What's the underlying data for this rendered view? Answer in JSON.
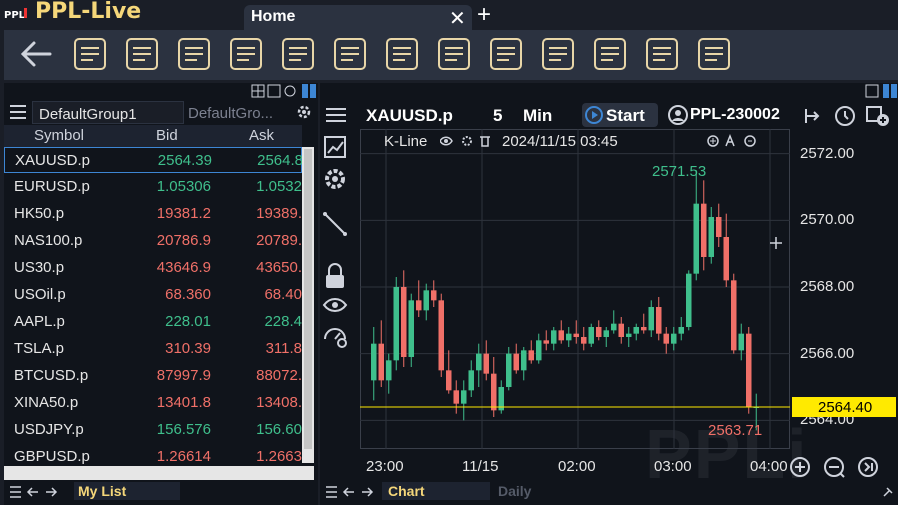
{
  "app": {
    "title": "PPL-Live",
    "logo_text": "PPLi"
  },
  "tabs": [
    {
      "label": "Home"
    }
  ],
  "toolbar_icons": [
    "list-icon",
    "favorite-list-icon",
    "favorite-settings-icon",
    "chart-signals-icon",
    "bar-chart-signals-icon",
    "strategy-cycle-icon",
    "flash-trade-icon",
    "calendar-icon",
    "lab-icon",
    "terminal-play-icon",
    "calculator-icon",
    "search-report-icon",
    "invoice-icon"
  ],
  "watchlist": {
    "groups": [
      "DefaultGroup1",
      "DefaultGro..."
    ],
    "columns": [
      "Symbol",
      "Bid",
      "Ask"
    ],
    "rows": [
      {
        "symbol": "XAUUSD.p",
        "bid": "2564.39",
        "ask": "2564.8",
        "dir": "up"
      },
      {
        "symbol": "EURUSD.p",
        "bid": "1.05306",
        "ask": "1.0532",
        "dir": "up"
      },
      {
        "symbol": "HK50.p",
        "bid": "19381.2",
        "ask": "19389.",
        "dir": "dn"
      },
      {
        "symbol": "NAS100.p",
        "bid": "20786.9",
        "ask": "20789.",
        "dir": "dn"
      },
      {
        "symbol": "US30.p",
        "bid": "43646.9",
        "ask": "43650.",
        "dir": "dn"
      },
      {
        "symbol": "USOil.p",
        "bid": "68.360",
        "ask": "68.40",
        "dir": "dn"
      },
      {
        "symbol": "AAPL.p",
        "bid": "228.01",
        "ask": "228.4",
        "dir": "up"
      },
      {
        "symbol": "TSLA.p",
        "bid": "310.39",
        "ask": "311.8",
        "dir": "dn"
      },
      {
        "symbol": "BTCUSD.p",
        "bid": "87997.9",
        "ask": "88072.",
        "dir": "dn"
      },
      {
        "symbol": "XINA50.p",
        "bid": "13401.8",
        "ask": "13408.",
        "dir": "dn"
      },
      {
        "symbol": "USDJPY.p",
        "bid": "156.576",
        "ask": "156.60",
        "dir": "up"
      },
      {
        "symbol": "GBPUSD.p",
        "bid": "1.26614",
        "ask": "1.2663",
        "dir": "dn"
      }
    ],
    "footer_tab": "My List"
  },
  "chart": {
    "symbol": "XAUUSD.p",
    "period": "5",
    "period_unit": "Min",
    "start_label": "Start",
    "account": "PPL-230002",
    "kline_label": "K-Line",
    "datetime": "2024/11/15 03:45",
    "y_ticks": [
      "2572.00",
      "2570.00",
      "2568.00",
      "2566.00",
      "2564.00"
    ],
    "x_ticks": [
      "23:00",
      "11/15",
      "02:00",
      "03:00",
      "04:00"
    ],
    "current_price": "2564.40",
    "high_label": "2571.53",
    "low_label": "2563.71",
    "footer_tabs": [
      "Chart",
      "Daily"
    ],
    "colors": {
      "up": "#3fbf8c",
      "down": "#f07068",
      "price_line": "#ffea00"
    }
  },
  "chart_data": {
    "type": "candlestick",
    "ylim": [
      2563.5,
      2572.5
    ],
    "ohlc": [
      [
        2565.2,
        2566.8,
        2564.6,
        2566.3
      ],
      [
        2566.3,
        2567.0,
        2565.0,
        2565.2
      ],
      [
        2565.2,
        2566.0,
        2564.8,
        2565.8
      ],
      [
        2565.8,
        2568.3,
        2565.5,
        2568.0
      ],
      [
        2568.0,
        2568.5,
        2565.6,
        2565.9
      ],
      [
        2565.9,
        2567.8,
        2565.6,
        2567.6
      ],
      [
        2567.6,
        2568.2,
        2567.1,
        2567.3
      ],
      [
        2567.3,
        2568.1,
        2567.0,
        2567.9
      ],
      [
        2567.9,
        2568.2,
        2567.4,
        2567.6
      ],
      [
        2567.6,
        2567.8,
        2565.3,
        2565.5
      ],
      [
        2565.5,
        2566.1,
        2564.8,
        2564.9
      ],
      [
        2564.9,
        2565.2,
        2564.2,
        2564.5
      ],
      [
        2564.5,
        2565.2,
        2564.0,
        2564.9
      ],
      [
        2564.9,
        2565.8,
        2564.7,
        2565.5
      ],
      [
        2565.5,
        2566.3,
        2565.0,
        2566.0
      ],
      [
        2566.0,
        2566.4,
        2565.2,
        2565.4
      ],
      [
        2565.4,
        2565.9,
        2564.1,
        2564.3
      ],
      [
        2564.3,
        2565.2,
        2564.2,
        2565.0
      ],
      [
        2565.0,
        2566.2,
        2564.9,
        2566.0
      ],
      [
        2566.0,
        2566.3,
        2565.4,
        2565.5
      ],
      [
        2565.5,
        2566.2,
        2565.2,
        2566.1
      ],
      [
        2566.1,
        2566.4,
        2565.7,
        2565.8
      ],
      [
        2565.8,
        2566.6,
        2565.7,
        2566.4
      ],
      [
        2566.4,
        2566.7,
        2566.1,
        2566.3
      ],
      [
        2566.3,
        2566.8,
        2566.1,
        2566.7
      ],
      [
        2566.7,
        2567.0,
        2566.3,
        2566.4
      ],
      [
        2566.4,
        2566.8,
        2566.2,
        2566.6
      ],
      [
        2566.6,
        2567.0,
        2566.3,
        2566.5
      ],
      [
        2566.5,
        2566.8,
        2566.1,
        2566.3
      ],
      [
        2566.3,
        2566.9,
        2566.2,
        2566.8
      ],
      [
        2566.8,
        2567.0,
        2566.4,
        2566.5
      ],
      [
        2566.5,
        2566.8,
        2566.2,
        2566.7
      ],
      [
        2566.7,
        2567.3,
        2566.6,
        2566.9
      ],
      [
        2566.9,
        2567.1,
        2566.3,
        2566.5
      ],
      [
        2566.5,
        2566.8,
        2566.2,
        2566.6
      ],
      [
        2566.6,
        2566.9,
        2566.4,
        2566.8
      ],
      [
        2566.8,
        2567.2,
        2566.6,
        2566.7
      ],
      [
        2566.7,
        2567.6,
        2566.5,
        2567.4
      ],
      [
        2567.4,
        2567.7,
        2566.4,
        2566.6
      ],
      [
        2566.6,
        2566.8,
        2566.0,
        2566.3
      ],
      [
        2566.3,
        2566.8,
        2566.1,
        2566.6
      ],
      [
        2566.6,
        2567.1,
        2566.4,
        2566.8
      ],
      [
        2566.8,
        2568.5,
        2566.7,
        2568.4
      ],
      [
        2568.4,
        2571.5,
        2568.2,
        2570.5
      ],
      [
        2570.5,
        2571.2,
        2568.5,
        2568.9
      ],
      [
        2568.9,
        2570.4,
        2568.7,
        2570.1
      ],
      [
        2570.1,
        2570.5,
        2569.2,
        2569.5
      ],
      [
        2569.5,
        2570.2,
        2568.0,
        2568.2
      ],
      [
        2568.2,
        2568.4,
        2566.0,
        2566.1
      ],
      [
        2566.1,
        2566.9,
        2565.8,
        2566.6
      ],
      [
        2566.6,
        2566.8,
        2564.2,
        2564.4
      ],
      [
        2564.4,
        2564.8,
        2563.7,
        2564.4
      ]
    ]
  }
}
